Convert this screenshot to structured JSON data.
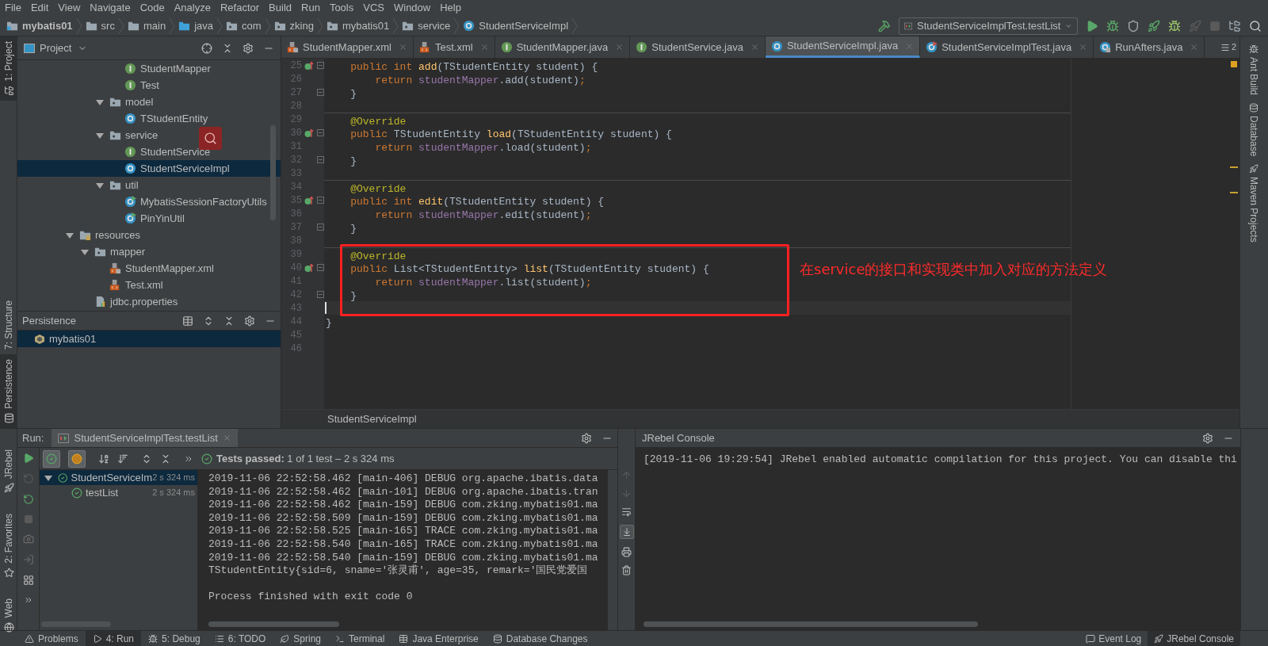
{
  "menu": [
    "File",
    "Edit",
    "View",
    "Navigate",
    "Code",
    "Analyze",
    "Refactor",
    "Build",
    "Run",
    "Tools",
    "VCS",
    "Window",
    "Help"
  ],
  "breadcrumbs": [
    {
      "label": "mybatis01",
      "kind": "module"
    },
    {
      "label": "src",
      "kind": "folder"
    },
    {
      "label": "main",
      "kind": "folder"
    },
    {
      "label": "java",
      "kind": "source"
    },
    {
      "label": "com",
      "kind": "package"
    },
    {
      "label": "zking",
      "kind": "package"
    },
    {
      "label": "mybatis01",
      "kind": "package"
    },
    {
      "label": "service",
      "kind": "package"
    },
    {
      "label": "StudentServiceImpl",
      "kind": "class"
    }
  ],
  "run_config": "StudentServiceImplTest.testList",
  "left_strip": {
    "top": [
      {
        "label": "1: Project",
        "selected": true
      }
    ],
    "middle": [
      {
        "label": "7: Structure",
        "selected": false
      },
      {
        "label": "Persistence",
        "selected": true
      }
    ],
    "bottom": [
      {
        "label": "JRebel",
        "selected": false
      },
      {
        "label": "2: Favorites",
        "selected": false
      },
      {
        "label": "Web",
        "selected": false
      }
    ]
  },
  "right_strip": [
    {
      "label": "Ant Build"
    },
    {
      "label": "Database"
    },
    {
      "label": "Maven Projects"
    }
  ],
  "project_panel": {
    "title": "Project",
    "tree": [
      {
        "kind": "offscreen",
        "children": [
          {
            "kind": "offscreen",
            "children": [
              {
                "kind": "offscreen",
                "children": [
                  {
                    "label": "StudentMapper",
                    "kind": "interface",
                    "selected": false
                  },
                  {
                    "label": "Test",
                    "kind": "interface",
                    "selected": false
                  }
                ]
              },
              {
                "label": "model",
                "kind": "package",
                "expanded": true,
                "selected": false,
                "children": [
                  {
                    "label": "TStudentEntity",
                    "kind": "class",
                    "selected": false
                  }
                ]
              },
              {
                "label": "service",
                "kind": "package",
                "expanded": true,
                "selected": false,
                "children": [
                  {
                    "label": "StudentService",
                    "kind": "interface",
                    "selected": false
                  },
                  {
                    "label": "StudentServiceImpl",
                    "kind": "class",
                    "selected": true
                  }
                ]
              },
              {
                "label": "util",
                "kind": "package",
                "expanded": true,
                "selected": false,
                "children": [
                  {
                    "label": "MybatisSessionFactoryUtils",
                    "kind": "runnable",
                    "selected": false
                  },
                  {
                    "label": "PinYinUtil",
                    "kind": "runnable",
                    "selected": false
                  }
                ]
              }
            ]
          }
        ]
      },
      {
        "label": "resources",
        "kind": "resources",
        "expanded": true,
        "selected": false,
        "children": [
          {
            "label": "mapper",
            "kind": "package",
            "expanded": true,
            "selected": false,
            "children": [
              {
                "label": "StudentMapper.xml",
                "kind": "xml-locked",
                "selected": false
              },
              {
                "label": "Test.xml",
                "kind": "xml",
                "selected": false
              }
            ]
          },
          {
            "label": "jdbc.properties",
            "kind": "properties",
            "selected": false
          }
        ]
      }
    ]
  },
  "persistence": {
    "title": "Persistence",
    "items": [
      {
        "label": "mybatis01",
        "selected": true
      }
    ]
  },
  "editor": {
    "tabs": [
      {
        "label": "StudentMapper.xml",
        "kind": "xml-locked",
        "selected": false
      },
      {
        "label": "Test.xml",
        "kind": "xml",
        "selected": false
      },
      {
        "label": "StudentMapper.java",
        "kind": "interface",
        "selected": false
      },
      {
        "label": "StudentService.java",
        "kind": "interface",
        "selected": false
      },
      {
        "label": "StudentServiceImpl.java",
        "kind": "class",
        "selected": true
      },
      {
        "label": "StudentServiceImplTest.java",
        "kind": "test",
        "selected": false
      },
      {
        "label": "RunAfters.java",
        "kind": "class-locked",
        "selected": false
      }
    ],
    "overflow_count": "2",
    "lines": [
      {
        "number": "25",
        "marker": true,
        "fold": true,
        "separator": false,
        "current": false,
        "tokens": [
          {
            "kind": "keyword",
            "text": "    public int "
          },
          {
            "kind": "method",
            "text": "add"
          },
          {
            "kind": "plain",
            "text": "(TStudentEntity student) {"
          }
        ]
      },
      {
        "number": "26",
        "marker": false,
        "fold": false,
        "separator": false,
        "current": false,
        "tokens": [
          {
            "kind": "keyword",
            "text": "        return "
          },
          {
            "kind": "field",
            "text": "studentMapper"
          },
          {
            "kind": "plain",
            "text": ".add(student)"
          },
          {
            "kind": "keyword",
            "text": ";"
          }
        ]
      },
      {
        "number": "27",
        "marker": false,
        "fold": true,
        "separator": false,
        "current": false,
        "tokens": [
          {
            "kind": "plain",
            "text": "    }"
          }
        ]
      },
      {
        "number": "28",
        "marker": false,
        "fold": false,
        "separator": false,
        "current": false
      },
      {
        "number": "29",
        "marker": false,
        "fold": false,
        "separator": true,
        "current": false,
        "tokens": [
          {
            "kind": "annotation",
            "text": "    @Override"
          }
        ]
      },
      {
        "number": "30",
        "marker": true,
        "fold": true,
        "separator": false,
        "current": false,
        "tokens": [
          {
            "kind": "keyword",
            "text": "    public "
          },
          {
            "kind": "plain",
            "text": "TStudentEntity "
          },
          {
            "kind": "method",
            "text": "load"
          },
          {
            "kind": "plain",
            "text": "(TStudentEntity student) {"
          }
        ]
      },
      {
        "number": "31",
        "marker": false,
        "fold": false,
        "separator": false,
        "current": false,
        "tokens": [
          {
            "kind": "keyword",
            "text": "        return "
          },
          {
            "kind": "field",
            "text": "studentMapper"
          },
          {
            "kind": "plain",
            "text": ".load(student)"
          },
          {
            "kind": "keyword",
            "text": ";"
          }
        ]
      },
      {
        "number": "32",
        "marker": false,
        "fold": true,
        "separator": false,
        "current": false,
        "tokens": [
          {
            "kind": "plain",
            "text": "    }"
          }
        ]
      },
      {
        "number": "33",
        "marker": false,
        "fold": false,
        "separator": false,
        "current": false
      },
      {
        "number": "34",
        "marker": false,
        "fold": false,
        "separator": true,
        "current": false,
        "tokens": [
          {
            "kind": "annotation",
            "text": "    @Override"
          }
        ]
      },
      {
        "number": "35",
        "marker": true,
        "fold": true,
        "separator": false,
        "current": false,
        "tokens": [
          {
            "kind": "keyword",
            "text": "    public int "
          },
          {
            "kind": "method",
            "text": "edit"
          },
          {
            "kind": "plain",
            "text": "(TStudentEntity student) {"
          }
        ]
      },
      {
        "number": "36",
        "marker": false,
        "fold": false,
        "separator": false,
        "current": false,
        "tokens": [
          {
            "kind": "keyword",
            "text": "        return "
          },
          {
            "kind": "field",
            "text": "studentMapper"
          },
          {
            "kind": "plain",
            "text": ".edit(student)"
          },
          {
            "kind": "keyword",
            "text": ";"
          }
        ]
      },
      {
        "number": "37",
        "marker": false,
        "fold": true,
        "separator": false,
        "current": false,
        "tokens": [
          {
            "kind": "plain",
            "text": "    }"
          }
        ]
      },
      {
        "number": "38",
        "marker": false,
        "fold": false,
        "separator": false,
        "current": false
      },
      {
        "number": "39",
        "marker": false,
        "fold": false,
        "separator": true,
        "current": false,
        "tokens": [
          {
            "kind": "annotation",
            "text": "    @Override"
          }
        ]
      },
      {
        "number": "40",
        "marker": true,
        "fold": true,
        "separator": false,
        "current": false,
        "tokens": [
          {
            "kind": "keyword",
            "text": "    public "
          },
          {
            "kind": "plain",
            "text": "List<TStudentEntity> "
          },
          {
            "kind": "method",
            "text": "list"
          },
          {
            "kind": "plain",
            "text": "(TStudentEntity student) {"
          }
        ]
      },
      {
        "number": "41",
        "marker": false,
        "fold": false,
        "separator": false,
        "current": false,
        "tokens": [
          {
            "kind": "keyword",
            "text": "        return "
          },
          {
            "kind": "field",
            "text": "studentMapper"
          },
          {
            "kind": "plain",
            "text": ".list(student)"
          },
          {
            "kind": "keyword",
            "text": ";"
          }
        ]
      },
      {
        "number": "42",
        "marker": false,
        "fold": true,
        "separator": false,
        "current": false,
        "tokens": [
          {
            "kind": "plain",
            "text": "    }"
          }
        ]
      },
      {
        "number": "43",
        "marker": false,
        "fold": false,
        "separator": false,
        "current": true
      },
      {
        "number": "44",
        "marker": false,
        "fold": false,
        "separator": false,
        "current": false,
        "tokens": [
          {
            "kind": "plain",
            "text": "}"
          }
        ]
      },
      {
        "number": "45",
        "marker": false,
        "fold": false,
        "separator": false,
        "current": false
      },
      {
        "number": "46",
        "marker": false,
        "fold": false,
        "separator": false,
        "current": false
      }
    ],
    "annotation": {
      "text": "在service的接口和实现类中加入对应的方法定义"
    },
    "breadcrumb": "StudentServiceImpl"
  },
  "run_panel": {
    "label": "Run:",
    "tab": "StudentServiceImplTest.testList",
    "status": "**Tests passed:** 1 of 1 test – 2 s 324 ms",
    "tests": [
      {
        "label": "StudentServiceIm",
        "time": "2 s 324 ms",
        "expanded": true,
        "selected": true,
        "children": [
          {
            "label": "testList",
            "time": "2 s 324 ms",
            "selected": false
          }
        ]
      }
    ],
    "output": [
      "2019-11-06 22:52:58.462 [main-406] DEBUG org.apache.ibatis.data",
      "2019-11-06 22:52:58.462 [main-101] DEBUG org.apache.ibatis.tran",
      "2019-11-06 22:52:58.462 [main-159] DEBUG com.zking.mybatis01.ma",
      "2019-11-06 22:52:58.509 [main-159] DEBUG com.zking.mybatis01.ma",
      "2019-11-06 22:52:58.525 [main-165] TRACE com.zking.mybatis01.ma",
      "2019-11-06 22:52:58.540 [main-165] TRACE com.zking.mybatis01.ma",
      "2019-11-06 22:52:58.540 [main-159] DEBUG com.zking.mybatis01.ma",
      "TStudentEntity{sid=6, sname='张灵甫', age=35, remark='国民党爱国"
    ],
    "exit_message": "Process finished with exit code 0"
  },
  "jrebel_console": {
    "title": "JRebel Console",
    "lines": [
      "[2019-11-06 19:29:54] JRebel enabled automatic compilation for this project. You can disable thi"
    ]
  },
  "tool_tabs": {
    "left": [
      {
        "label": "Problems",
        "selected": false
      },
      {
        "label": "4: Run",
        "selected": true
      },
      {
        "label": "5: Debug",
        "selected": false
      },
      {
        "label": "6: TODO",
        "selected": false
      },
      {
        "label": "Spring",
        "selected": false
      },
      {
        "label": "Terminal",
        "selected": false
      },
      {
        "label": "Java Enterprise",
        "selected": false
      },
      {
        "label": "Database Changes",
        "selected": false
      }
    ],
    "right": [
      {
        "label": "Event Log",
        "selected": false
      },
      {
        "label": "JRebel Console",
        "selected": true
      }
    ]
  }
}
